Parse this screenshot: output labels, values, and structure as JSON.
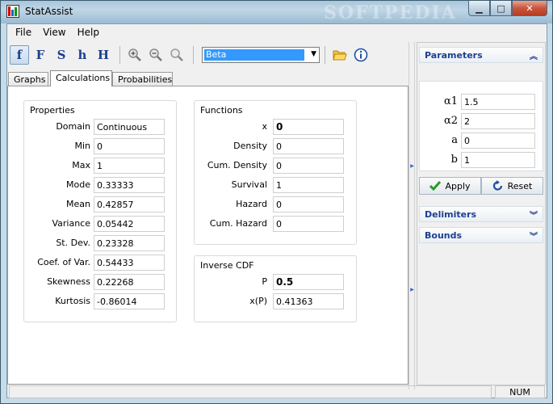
{
  "window": {
    "title": "StatAssist",
    "watermark": "SOFTPEDIA",
    "min_glyph": "▁",
    "max_glyph": "□",
    "close_glyph": "✕"
  },
  "menu": {
    "file": "File",
    "view": "View",
    "help": "Help"
  },
  "toolbar": {
    "f_label": "f",
    "F_label": "F",
    "S_label": "S",
    "h_label": "h",
    "H_label": "H",
    "distribution_selected": "Beta"
  },
  "tabs": {
    "graphs": "Graphs",
    "calculations": "Calculations",
    "probabilities": "Probabilities"
  },
  "properties": {
    "title": "Properties",
    "rows": [
      {
        "label": "Domain",
        "value": "Continuous"
      },
      {
        "label": "Min",
        "value": "0"
      },
      {
        "label": "Max",
        "value": "1"
      },
      {
        "label": "Mode",
        "value": "0.33333"
      },
      {
        "label": "Mean",
        "value": "0.42857"
      },
      {
        "label": "Variance",
        "value": "0.05442"
      },
      {
        "label": "St. Dev.",
        "value": "0.23328"
      },
      {
        "label": "Coef. of Var.",
        "value": "0.54433"
      },
      {
        "label": "Skewness",
        "value": "0.22268"
      },
      {
        "label": "Kurtosis",
        "value": "-0.86014"
      }
    ]
  },
  "functions": {
    "title": "Functions",
    "rows": [
      {
        "label": "x",
        "value": "0"
      },
      {
        "label": "Density",
        "value": "0"
      },
      {
        "label": "Cum. Density",
        "value": "0"
      },
      {
        "label": "Survival",
        "value": "1"
      },
      {
        "label": "Hazard",
        "value": "0"
      },
      {
        "label": "Cum. Hazard",
        "value": "0"
      }
    ]
  },
  "inverse_cdf": {
    "title": "Inverse CDF",
    "p_label": "P",
    "p_value": "0.5",
    "xp_label": "x(P)",
    "xp_value": "0.41363"
  },
  "side": {
    "parameters_title": "Parameters",
    "params": [
      {
        "label": "α1",
        "value": "1.5"
      },
      {
        "label": "α2",
        "value": "2"
      },
      {
        "label": "a",
        "value": "0"
      },
      {
        "label": "b",
        "value": "1"
      }
    ],
    "apply_label": "Apply",
    "reset_label": "Reset",
    "delimiters_title": "Delimiters",
    "bounds_title": "Bounds"
  },
  "status": {
    "num": "NUM"
  },
  "colors": {
    "accent": "#1c3f8f",
    "selection": "#3399ff"
  }
}
